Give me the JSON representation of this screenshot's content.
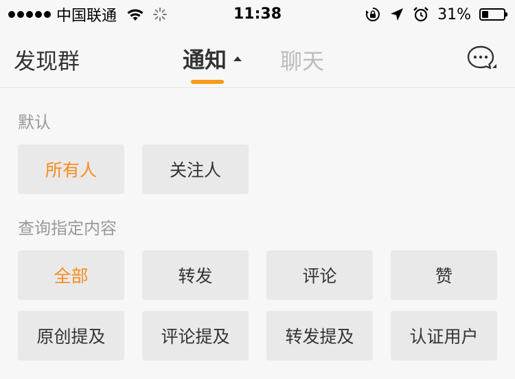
{
  "status_bar": {
    "carrier": "中国联通",
    "time": "11:38",
    "battery_percent": "31%",
    "battery_level": 0.31,
    "icons": [
      "signal-dots-icon",
      "wifi-icon",
      "activity-spinner-icon",
      "rotation-lock-icon",
      "location-arrow-icon",
      "alarm-clock-icon",
      "battery-icon"
    ]
  },
  "nav": {
    "left_label": "发现群",
    "tab_active": "通知",
    "tab_other": "聊天",
    "accent": "#f79b1c",
    "right_icon": "chat-bubble-icon"
  },
  "sections": {
    "default_label": "默认",
    "default_options": [
      "所有人",
      "关注人"
    ],
    "query_label": "查询指定内容",
    "query_options": [
      "全部",
      "转发",
      "评论",
      "赞",
      "原创提及",
      "评论提及",
      "转发提及",
      "认证用户"
    ]
  },
  "colors": {
    "selected_text": "#f78c1d",
    "option_bg": "#e9e9e9",
    "page_bg": "#f7f7f7"
  }
}
